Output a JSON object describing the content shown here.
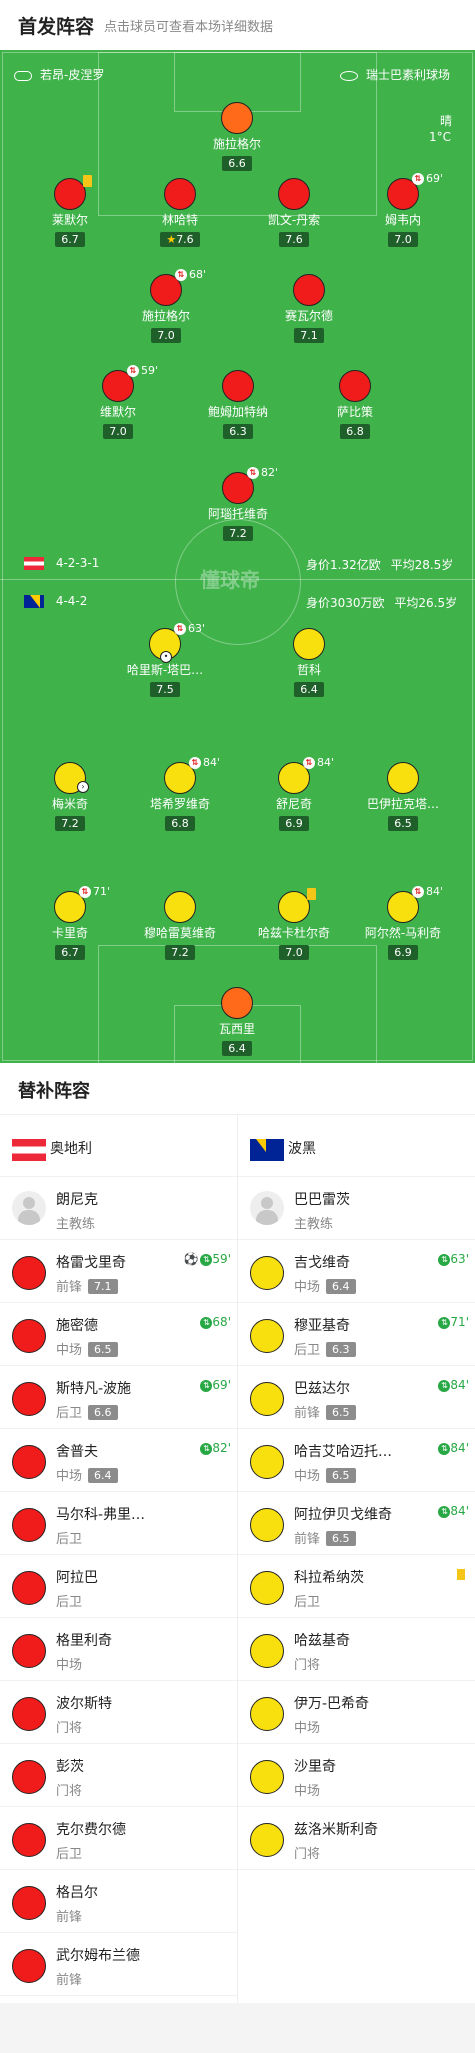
{
  "header": {
    "title": "首发阵容",
    "subtitle": "点击球员可查看本场详细数据"
  },
  "pitch": {
    "home_coach": "若昂-皮涅罗",
    "stadium": "瑞士巴素利球场",
    "weather": "晴",
    "temperature": "1°C",
    "watermark": "懂球帝",
    "home_formation": "4-2-3-1",
    "home_value": "身价1.32亿欧",
    "home_age": "平均28.5岁",
    "away_formation": "4-4-2",
    "away_value": "身价3030万欧",
    "away_age": "平均26.5岁"
  },
  "home_players": [
    {
      "name": "施拉格尔",
      "rating": "6.6",
      "color": "orange"
    },
    {
      "name": "莱默尔",
      "rating": "6.7",
      "card": "yellow"
    },
    {
      "name": "林哈特",
      "rating": "7.6",
      "star": true
    },
    {
      "name": "凯文-丹索",
      "rating": "7.6"
    },
    {
      "name": "姆韦内",
      "rating": "7.0",
      "sub": "69'"
    },
    {
      "name": "施拉格尔",
      "rating": "7.0",
      "sub": "68'"
    },
    {
      "name": "赛瓦尔德",
      "rating": "7.1"
    },
    {
      "name": "维默尔",
      "rating": "7.0",
      "sub": "59'"
    },
    {
      "name": "鲍姆加特纳",
      "rating": "6.3"
    },
    {
      "name": "萨比策",
      "rating": "6.8"
    },
    {
      "name": "阿瑙托维奇",
      "rating": "7.2",
      "sub": "82'"
    }
  ],
  "away_players": [
    {
      "name": "哈里斯-塔巴…",
      "rating": "7.5",
      "sub": "63'",
      "goal": true
    },
    {
      "name": "哲科",
      "rating": "6.4"
    },
    {
      "name": "梅米奇",
      "rating": "7.2",
      "assist": true
    },
    {
      "name": "塔希罗维奇",
      "rating": "6.8",
      "sub": "84'"
    },
    {
      "name": "舒尼奇",
      "rating": "6.9",
      "sub": "84'"
    },
    {
      "name": "巴伊拉克塔…",
      "rating": "6.5"
    },
    {
      "name": "卡里奇",
      "rating": "6.7",
      "sub": "71'"
    },
    {
      "name": "穆哈雷莫维奇",
      "rating": "7.2"
    },
    {
      "name": "哈兹卡杜尔奇",
      "rating": "7.0",
      "card": "yellow"
    },
    {
      "name": "阿尔然-马利奇",
      "rating": "6.9",
      "sub": "84'"
    },
    {
      "name": "瓦西里",
      "rating": "6.4",
      "color": "orange"
    }
  ],
  "subs": {
    "title": "替补阵容",
    "home": {
      "team": "奥地利",
      "coach": {
        "name": "朗尼克",
        "role": "主教练"
      },
      "players": [
        {
          "name": "格雷戈里奇",
          "pos": "前锋",
          "rating": "7.1",
          "event": "59'",
          "goal": true
        },
        {
          "name": "施密德",
          "pos": "中场",
          "rating": "6.5",
          "event": "68'"
        },
        {
          "name": "斯特凡-波施",
          "pos": "后卫",
          "rating": "6.6",
          "event": "69'"
        },
        {
          "name": "舍普夫",
          "pos": "中场",
          "rating": "6.4",
          "event": "82'"
        },
        {
          "name": "马尔科-弗里…",
          "pos": "后卫"
        },
        {
          "name": "阿拉巴",
          "pos": "后卫"
        },
        {
          "name": "格里利奇",
          "pos": "中场"
        },
        {
          "name": "波尔斯特",
          "pos": "门将"
        },
        {
          "name": "彭茨",
          "pos": "门将"
        },
        {
          "name": "克尔费尔德",
          "pos": "后卫"
        },
        {
          "name": "格吕尔",
          "pos": "前锋"
        },
        {
          "name": "武尔姆布兰德",
          "pos": "前锋"
        }
      ]
    },
    "away": {
      "team": "波黑",
      "coach": {
        "name": "巴巴雷茨",
        "role": "主教练"
      },
      "players": [
        {
          "name": "吉戈维奇",
          "pos": "中场",
          "rating": "6.4",
          "event": "63'"
        },
        {
          "name": "穆亚基奇",
          "pos": "后卫",
          "rating": "6.3",
          "event": "71'"
        },
        {
          "name": "巴兹达尔",
          "pos": "前锋",
          "rating": "6.5",
          "event": "84'"
        },
        {
          "name": "哈吉艾哈迈托…",
          "pos": "中场",
          "rating": "6.5",
          "event": "84'"
        },
        {
          "name": "阿拉伊贝戈维奇",
          "pos": "前锋",
          "rating": "6.5",
          "event": "84'"
        },
        {
          "name": "科拉希纳茨",
          "pos": "后卫",
          "card": "yellow"
        },
        {
          "name": "哈兹基奇",
          "pos": "门将"
        },
        {
          "name": "伊万-巴希奇",
          "pos": "中场"
        },
        {
          "name": "沙里奇",
          "pos": "中场"
        },
        {
          "name": "兹洛米斯利奇",
          "pos": "门将"
        }
      ]
    }
  },
  "colors": {
    "pitch": "#3fb24a",
    "home": "#f01c1c",
    "away": "#f8e00e",
    "gk": "#ff6a1a"
  }
}
